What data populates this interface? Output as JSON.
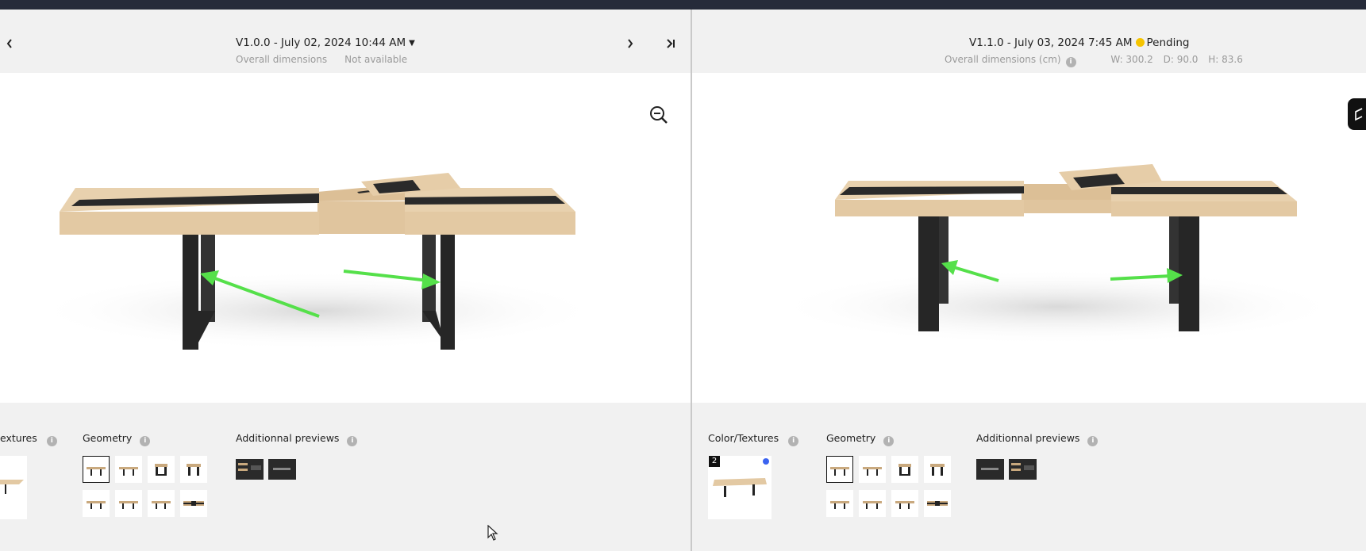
{
  "left_pane": {
    "version_label": "V1.0.0 - July 02, 2024 10:44 AM",
    "dimensions_label": "Overall dimensions",
    "dimensions_value": "Not available",
    "prev_icon": "chevron-left-icon",
    "next_icon": "chevron-right-icon",
    "last_icon": "skip-to-end-icon",
    "zoom_icon": "zoom-out-icon",
    "sections": {
      "color_textures": "extures",
      "geometry": "Geometry",
      "additional_previews": "Additionnal previews"
    }
  },
  "right_pane": {
    "version_label": "V1.1.0 - July 03, 2024 7:45 AM",
    "status": "Pending",
    "status_color": "#f5c400",
    "dimensions_label": "Overall dimensions (cm)",
    "width": "W: 300.2",
    "depth": "D: 90.0",
    "height": "H: 83.6",
    "box_icon": "cube-icon",
    "sections": {
      "color_textures": "Color/Textures",
      "geometry": "Geometry",
      "additional_previews": "Additionnal previews"
    },
    "texture_badge": "2"
  },
  "colors": {
    "topbar": "#262b3a",
    "arrow": "#55e04a",
    "wood": "#e3c9a3",
    "leg": "#262626",
    "accent_dot": "#3b63f0"
  }
}
